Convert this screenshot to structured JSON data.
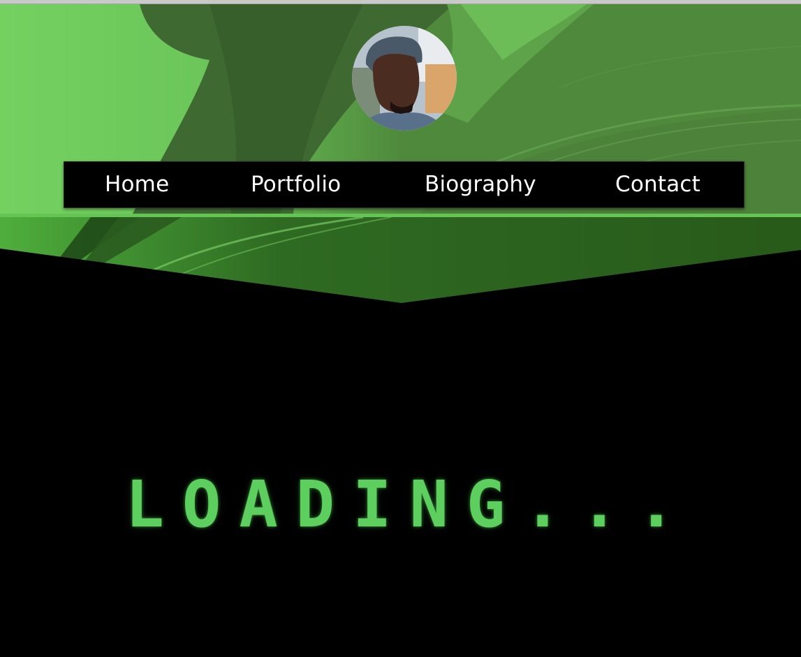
{
  "nav": {
    "home_label": "Home",
    "portfolio_label": "Portfolio",
    "biography_label": "Biography",
    "contact_label": "Contact"
  },
  "main": {
    "loading_text": "LOADING..."
  },
  "colors": {
    "accent_green": "#5ccf5e",
    "header_green": "#52883e",
    "dark_green": "#275718",
    "background": "#000000",
    "nav_background": "#000000",
    "nav_text": "#ffffff"
  },
  "icons": {
    "avatar": "profile-photo"
  }
}
